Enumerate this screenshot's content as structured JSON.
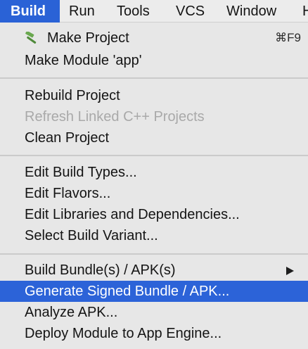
{
  "menubar": {
    "items": [
      "Build",
      "Run",
      "Tools",
      "VCS",
      "Window",
      "H"
    ]
  },
  "build_menu": {
    "make_project": {
      "label": "Make Project",
      "shortcut": "⌘F9",
      "icon": "hammer-icon"
    },
    "make_module": {
      "label": "Make Module 'app'"
    },
    "rebuild_project": {
      "label": "Rebuild Project"
    },
    "refresh_linked_cpp": {
      "label": "Refresh Linked C++ Projects"
    },
    "clean_project": {
      "label": "Clean Project"
    },
    "edit_build_types": {
      "label": "Edit Build Types..."
    },
    "edit_flavors": {
      "label": "Edit Flavors..."
    },
    "edit_libraries": {
      "label": "Edit Libraries and Dependencies..."
    },
    "select_build_variant": {
      "label": "Select Build Variant..."
    },
    "build_bundle_apk": {
      "label": "Build Bundle(s) / APK(s)"
    },
    "generate_signed": {
      "label": "Generate Signed Bundle / APK..."
    },
    "analyze_apk": {
      "label": "Analyze APK..."
    },
    "deploy_module": {
      "label": "Deploy Module to App Engine..."
    }
  },
  "colors": {
    "accent": "#2c63d8",
    "menu_background": "#e7e7e7",
    "disabled_text": "#a9a9a9"
  }
}
